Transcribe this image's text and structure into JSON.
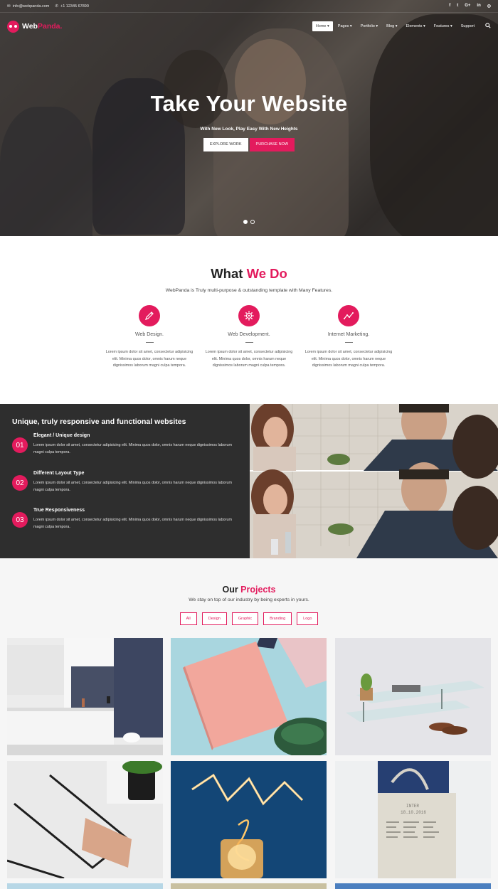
{
  "topbar": {
    "email": "info@webpanda.com",
    "phone": "+1 12345 67890",
    "socials": [
      "f",
      "t",
      "G+",
      "in",
      "◎"
    ]
  },
  "nav": {
    "logo_main": "Web",
    "logo_accent": "Panda.",
    "items": [
      "Home",
      "Pages",
      "Portfolio",
      "Blog",
      "Elements",
      "Features",
      "Support"
    ],
    "search_icon": "search-icon"
  },
  "hero": {
    "title": "Take Your Website",
    "subtitle": "With New Look, Play Easy With New Heights",
    "btn_explore": "EXPLORE WORK",
    "btn_purchase": "PURCHASE NOW"
  },
  "what_we_do": {
    "title_main": "What ",
    "title_accent": "We Do",
    "subtitle": "WebPanda is Truly multi-purpose & outstanding template with Many Features.",
    "services": [
      {
        "title": "Web Design.",
        "icon": "pencil-icon",
        "text": "Lorem ipsum dolor sit amet, consectetur adipisicing elit. Minima quos dolor, omnis harum neque dignissimos laborum magni culpa tempora."
      },
      {
        "title": "Web Development.",
        "icon": "gear-icon",
        "text": "Lorem ipsum dolor sit amet, consectetur adipisicing elit. Minima quos dolor, omnis harum neque dignissimos laborum magni culpa tempora."
      },
      {
        "title": "Internet Marketing.",
        "icon": "chart-icon",
        "text": "Lorem ipsum dolor sit amet, consectetur adipisicing elit. Minima quos dolor, omnis harum neque dignissimos laborum magni culpa tempora."
      }
    ]
  },
  "features": {
    "title": "Unique, truly responsive and functional websites",
    "items": [
      {
        "num": "01",
        "name": "Elegant / Unique design",
        "text": "Lorem ipsum dolor sit amet, consectetur adipisicing elit. Minima quos dolor, omnis harum neque dignissimos laborum magni culpa tempora."
      },
      {
        "num": "02",
        "name": "Different Layout Type",
        "text": "Lorem ipsum dolor sit amet, consectetur adipisicing elit. Minima quos dolor, omnis harum neque dignissimos laborum magni culpa tempora."
      },
      {
        "num": "03",
        "name": "True Responsiveness",
        "text": "Lorem ipsum dolor sit amet, consectetur adipisicing elit. Minima quos dolor, omnis harum neque dignissimos laborum magni culpa tempora."
      }
    ]
  },
  "projects": {
    "title_main": "Our ",
    "title_accent": "Projects",
    "subtitle": "We stay on top of our industry by being experts in yours.",
    "filters": [
      "All",
      "Design",
      "Graphic",
      "Branding",
      "Logo"
    ],
    "tote_text": "INTER\n18.10.2016"
  },
  "colors": {
    "accent": "#e31b5d",
    "dark": "#2e2e2e"
  }
}
